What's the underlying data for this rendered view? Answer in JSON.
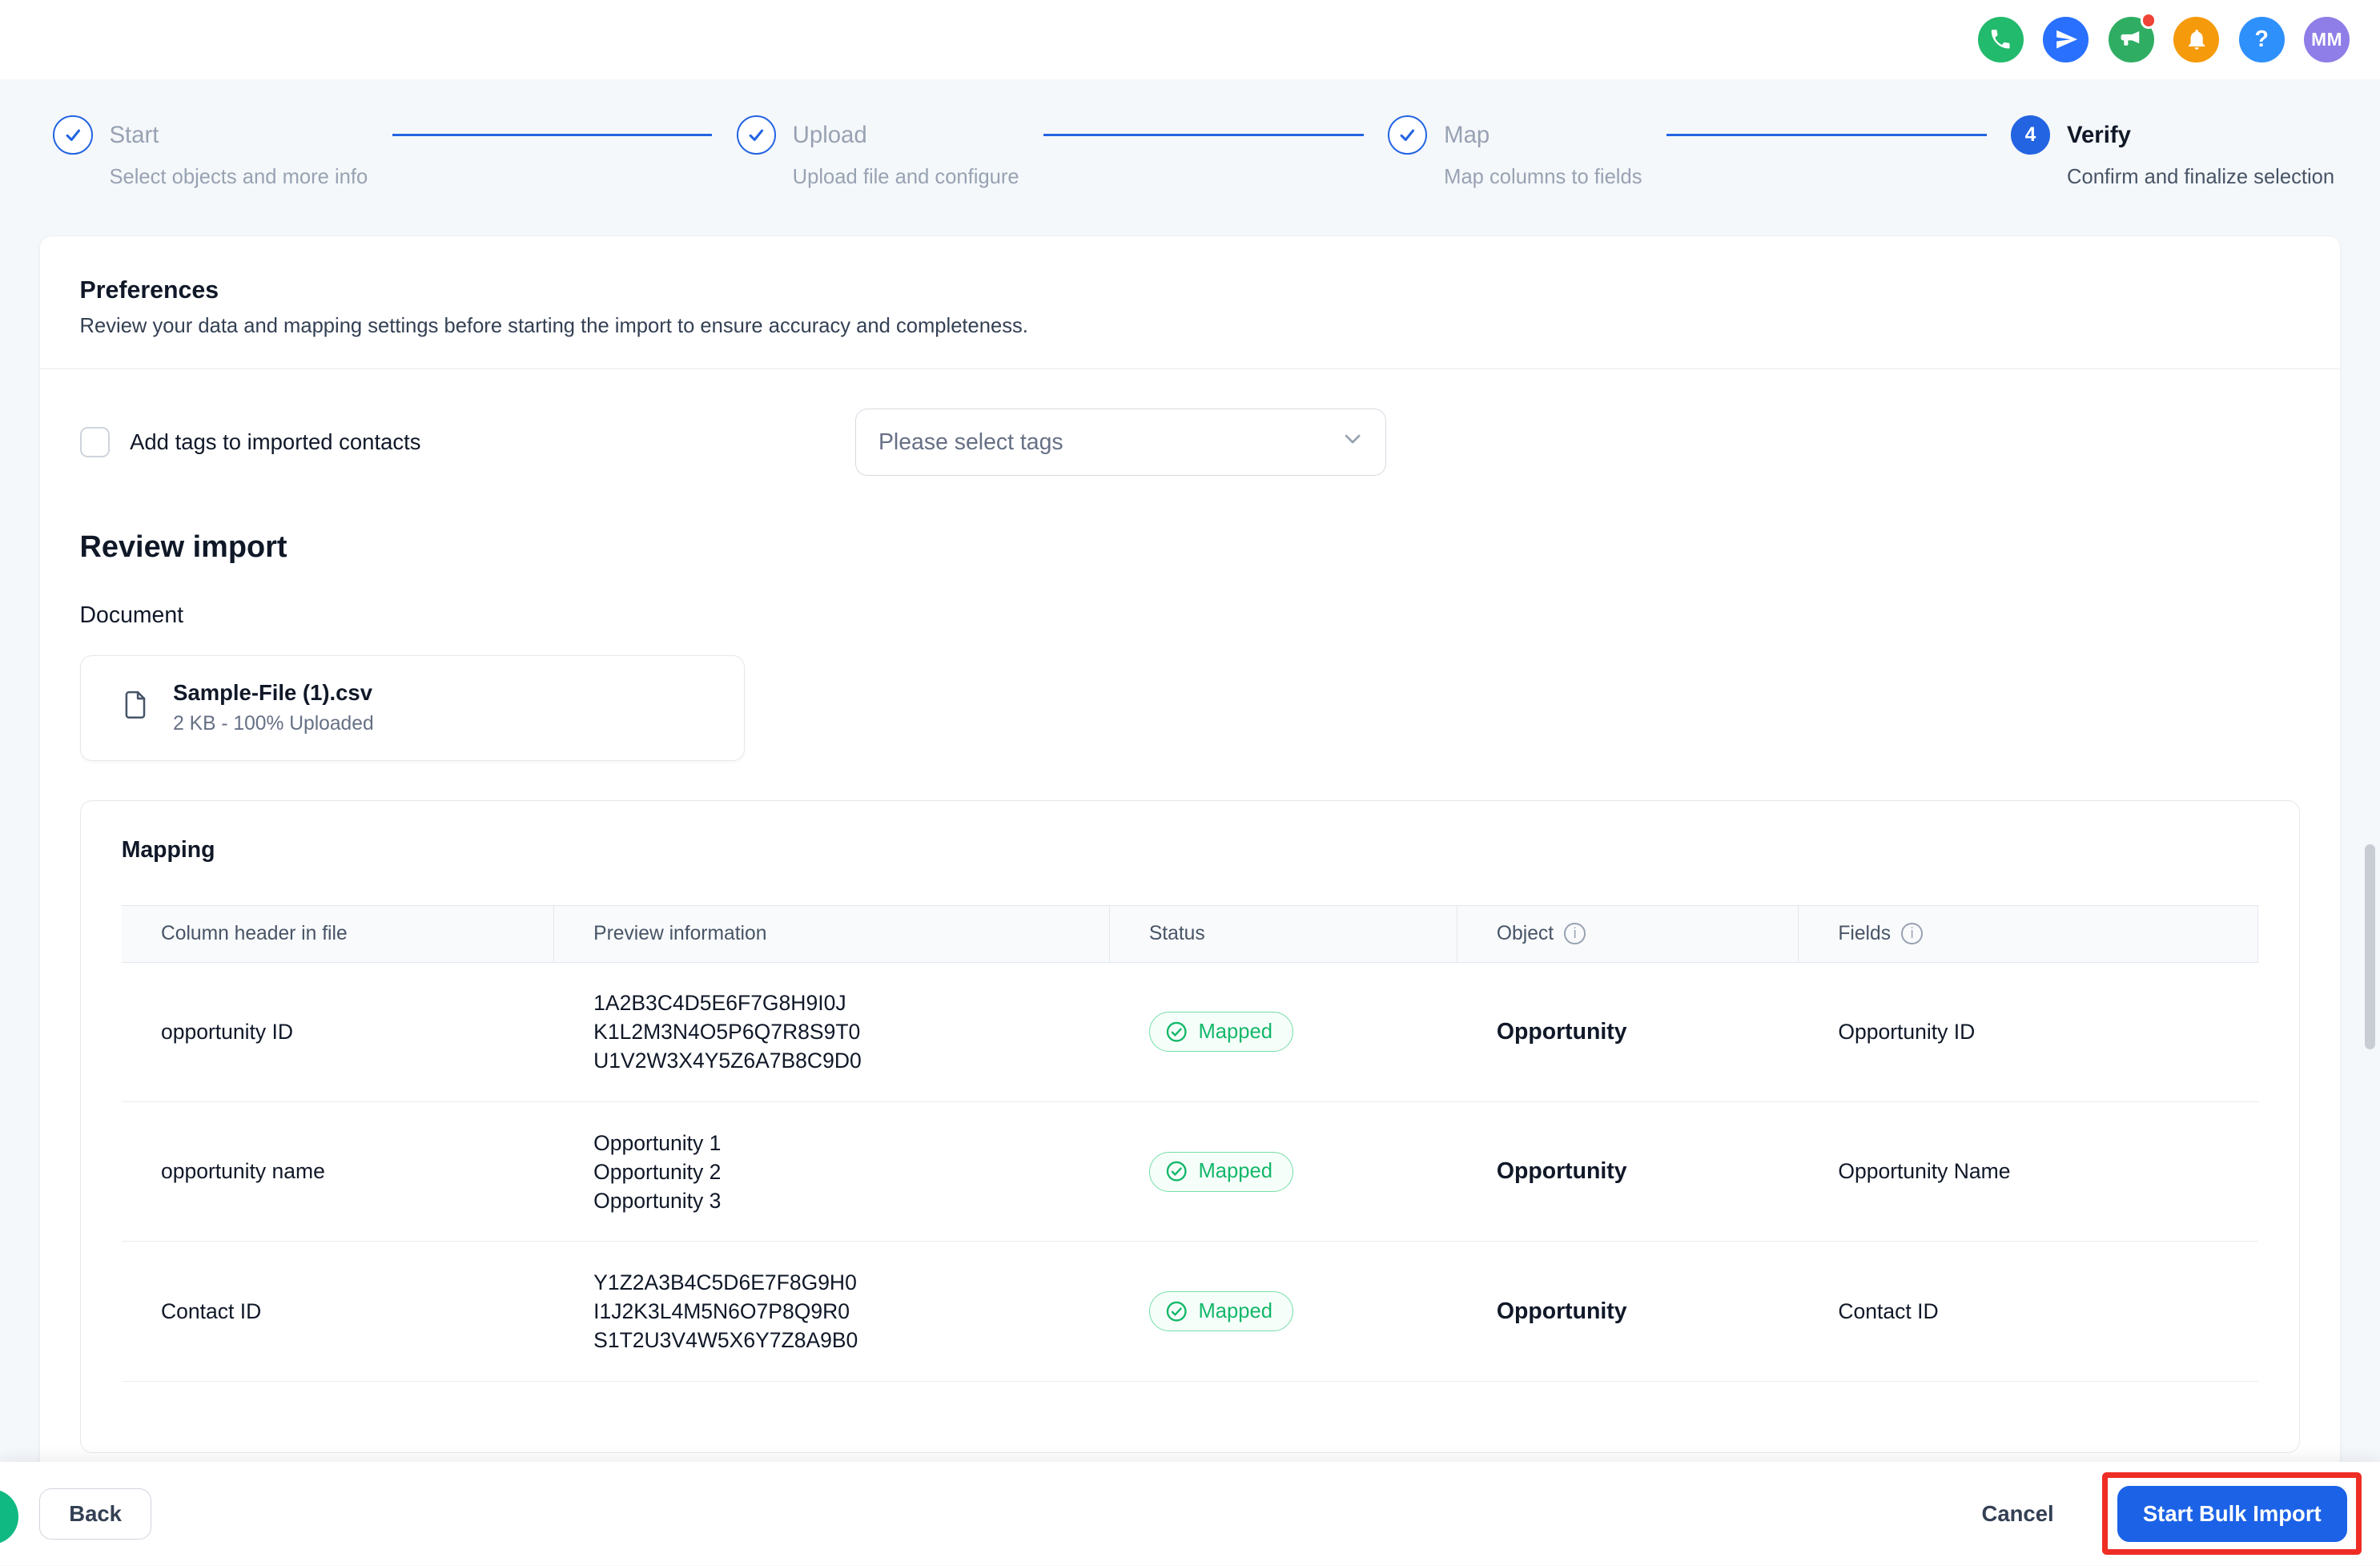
{
  "topbar": {
    "icons": [
      {
        "name": "phone-icon"
      },
      {
        "name": "paper-plane-icon"
      },
      {
        "name": "megaphone-icon",
        "badge": true
      },
      {
        "name": "bell-icon"
      },
      {
        "name": "help-icon",
        "glyph": "?"
      }
    ],
    "avatar_initials": "MM"
  },
  "stepper": {
    "steps": [
      {
        "label": "Start",
        "sublabel": "Select objects and more info",
        "state": "done"
      },
      {
        "label": "Upload",
        "sublabel": "Upload file and configure",
        "state": "done"
      },
      {
        "label": "Map",
        "sublabel": "Map columns to fields",
        "state": "done"
      },
      {
        "label": "Verify",
        "sublabel": "Confirm and finalize selection",
        "state": "current",
        "number": "4"
      }
    ]
  },
  "preferences": {
    "title": "Preferences",
    "description": "Review your data and mapping settings before starting the import to ensure accuracy and completeness.",
    "tags_checkbox_label": "Add tags to imported contacts",
    "tags_select_placeholder": "Please select tags"
  },
  "review": {
    "title": "Review import",
    "document_label": "Document",
    "file": {
      "name": "Sample-File (1).csv",
      "meta": "2 KB - 100% Uploaded"
    }
  },
  "mapping": {
    "title": "Mapping",
    "columns": [
      "Column header in file",
      "Preview information",
      "Status",
      "Object",
      "Fields"
    ],
    "rows": [
      {
        "header": "opportunity ID",
        "preview": [
          "1A2B3C4D5E6F7G8H9I0J",
          "K1L2M3N4O5P6Q7R8S9T0",
          "U1V2W3X4Y5Z6A7B8C9D0"
        ],
        "status": "Mapped",
        "object": "Opportunity",
        "field": "Opportunity ID"
      },
      {
        "header": "opportunity name",
        "preview": [
          "Opportunity 1",
          "Opportunity 2",
          "Opportunity 3"
        ],
        "status": "Mapped",
        "object": "Opportunity",
        "field": "Opportunity Name"
      },
      {
        "header": "Contact ID",
        "preview": [
          "Y1Z2A3B4C5D6E7F8G9H0",
          "I1J2K3L4M5N6O7P8Q9R0",
          "S1T2U3V4W5X6Y7Z8A9B0"
        ],
        "status": "Mapped",
        "object": "Opportunity",
        "field": "Contact ID"
      }
    ]
  },
  "footer": {
    "back_label": "Back",
    "cancel_label": "Cancel",
    "start_label": "Start Bulk Import"
  },
  "colors": {
    "accent_blue": "#2364e2",
    "success_green": "#12b76a",
    "notification_orange": "#f79009",
    "badge_red": "#f04438",
    "annotation_red": "#ee2d24"
  }
}
